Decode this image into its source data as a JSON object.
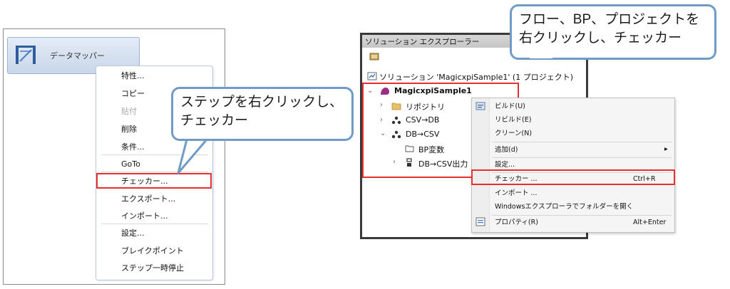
{
  "left": {
    "step_label": "データマッパー",
    "menu": [
      {
        "label": "特性...",
        "disabled": false
      },
      {
        "label": "コピー",
        "disabled": false
      },
      {
        "label": "貼付",
        "disabled": true
      },
      {
        "label": "削除",
        "disabled": false
      },
      {
        "label": "条件...",
        "disabled": false
      },
      {
        "label": "GoTo",
        "disabled": false
      },
      {
        "label": "チェッカー...",
        "disabled": false
      },
      {
        "label": "エクスポート...",
        "disabled": false
      },
      {
        "label": "インポート...",
        "disabled": false
      },
      {
        "label": "設定...",
        "disabled": false
      },
      {
        "label": "ブレイクポイント",
        "disabled": false
      },
      {
        "label": "ステップ一時停止",
        "disabled": false
      }
    ],
    "callout_line1": "ステップを右クリックし、",
    "callout_line2": "チェッカー"
  },
  "right": {
    "callout_line1": "フロー、BP、プロジェクトを",
    "callout_line2": "右クリックし、チェッカー",
    "explorer_title": "ソリューション エクスプローラー",
    "tree": {
      "solution": "ソリューション 'MagicxpiSample1' (1 プロジェクト)",
      "project": "MagicxpiSample1",
      "repository": "リポジトリ",
      "flow1": "CSV→DB",
      "flow2": "DB→CSV",
      "bp_vars": "BP変数",
      "bp_item": "DB→CSV出力"
    },
    "menu": {
      "build": "ビルド(U)",
      "rebuild": "リビルド(E)",
      "clean": "クリーン(N)",
      "add": "追加(d)",
      "settings": "設定...",
      "checker": "チェッカー ...",
      "checker_shortcut": "Ctrl+R",
      "import": "インポート ...",
      "open_folder": "Windowsエクスプローラでフォルダーを開く",
      "properties": "プロパティ(R)",
      "properties_shortcut": "Alt+Enter",
      "submenu_arrow": "▸"
    }
  },
  "colors": {
    "highlight": "#e53030",
    "callout_border": "#6f9bc6",
    "project_icon": "#9b2f86"
  }
}
